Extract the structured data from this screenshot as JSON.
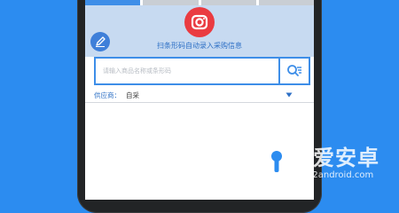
{
  "header": {
    "scan_hint": "扫条形码自动录入采购信息",
    "camera_icon": "camera-icon",
    "edit_icon": "pencil-icon"
  },
  "search": {
    "placeholder": "请输入商品名称或条形码",
    "value": "",
    "button_icon": "search-list-icon"
  },
  "supplier": {
    "label": "供应商：",
    "value": "自采",
    "arrow_icon": "triangle-down-icon"
  },
  "watermark": {
    "title": "我爱安卓",
    "subtitle": "52android.com"
  },
  "colors": {
    "background": "#2c8cf0",
    "accent": "#3e8ee8",
    "camera": "#ea3b41",
    "header_bg": "#c7daf1"
  }
}
